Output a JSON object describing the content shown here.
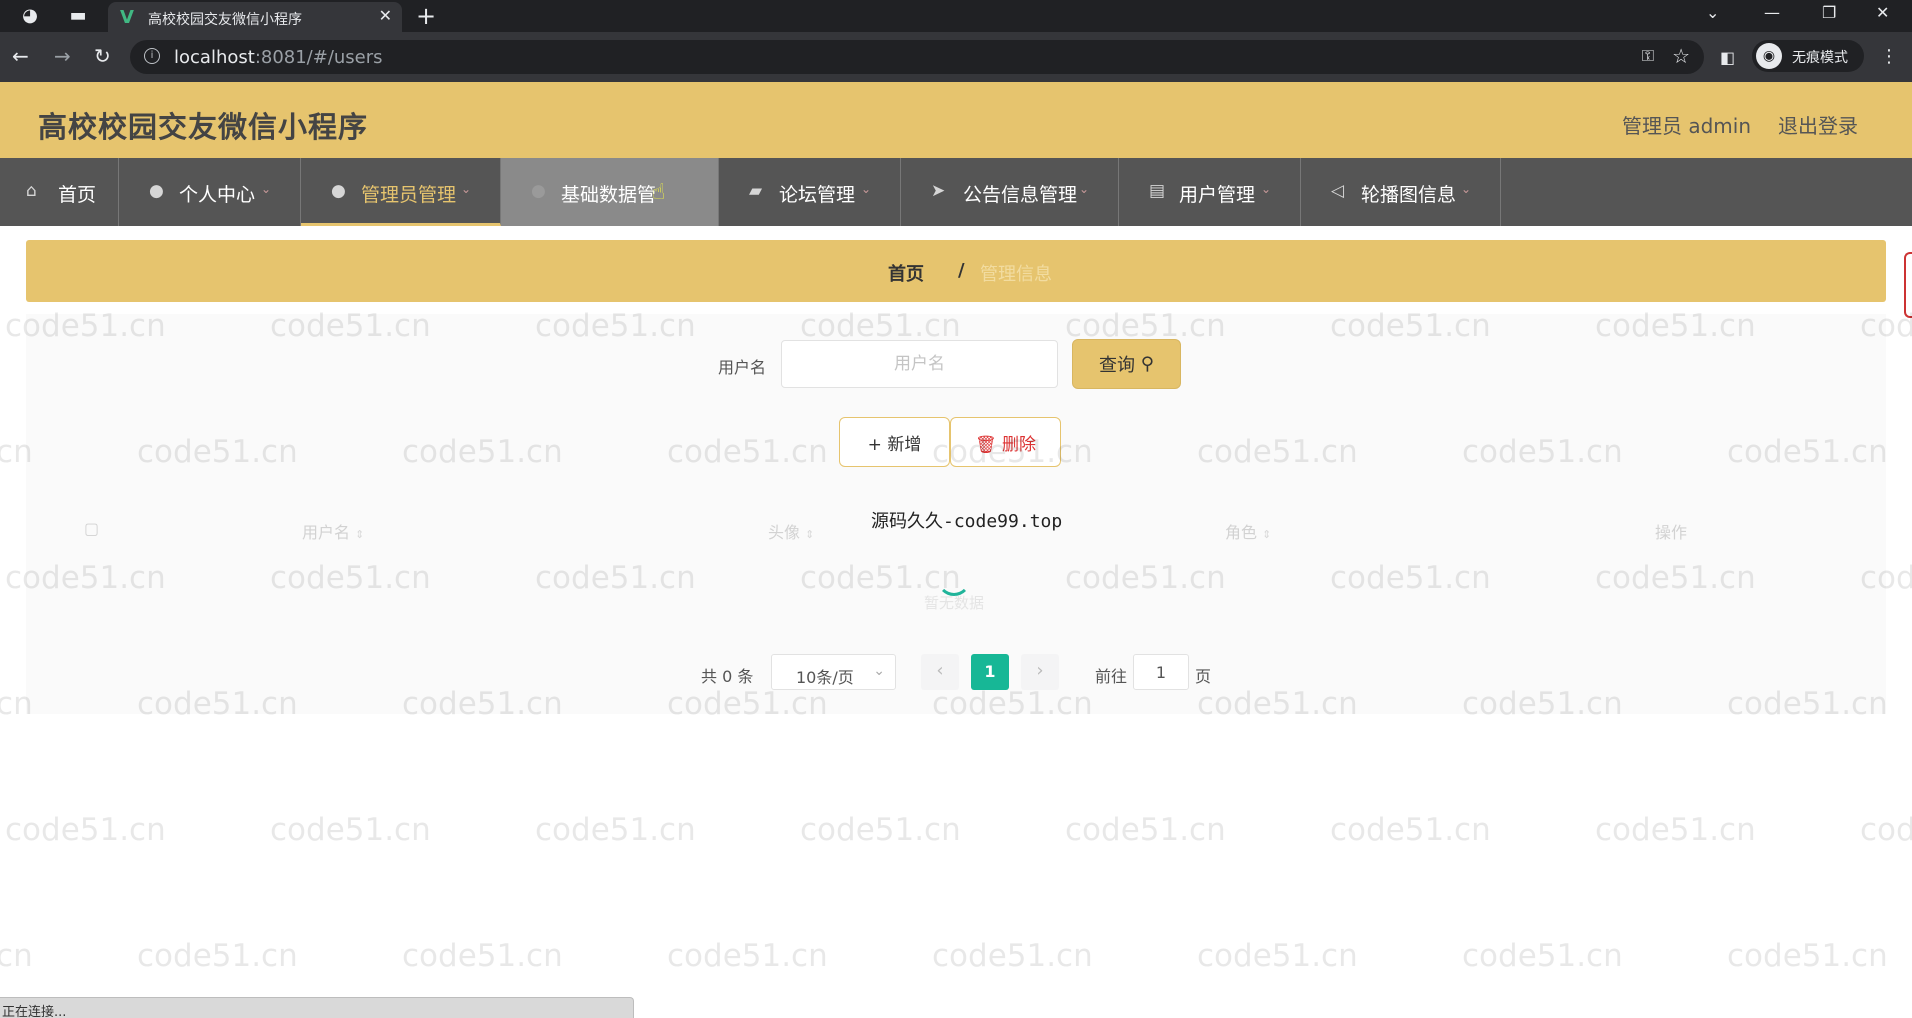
{
  "browser": {
    "tab_title": "高校校园交友微信小程序",
    "url_host": "localhost",
    "url_rest": ":8081/#/users",
    "incognito_label": "无痕模式",
    "status_text": "正在连接..."
  },
  "header": {
    "title": "高校校园交友微信小程序",
    "admin_label": "管理员 admin",
    "logout_label": "退出登录"
  },
  "nav": {
    "items": [
      {
        "label": "首页",
        "icon": "home-icon"
      },
      {
        "label": "个人中心",
        "icon": "person-icon"
      },
      {
        "label": "管理员管理",
        "icon": "person-icon"
      },
      {
        "label": "基础数据管",
        "icon": "person-icon"
      },
      {
        "label": "论坛管理",
        "icon": "briefcase-icon"
      },
      {
        "label": "公告信息管理",
        "icon": "send-icon"
      },
      {
        "label": "用户管理",
        "icon": "clipboard-icon"
      },
      {
        "label": "轮播图信息",
        "icon": "navigation-icon"
      }
    ],
    "active_index": 2,
    "hover_index": 3
  },
  "breadcrumb": {
    "home": "首页",
    "separator": "/",
    "current": "管理信息"
  },
  "search": {
    "label": "用户名",
    "placeholder": "用户名",
    "value": "",
    "button_label": "查询"
  },
  "actions": {
    "add_label": "新增",
    "delete_label": "删除"
  },
  "table": {
    "columns": [
      "用户名",
      "头像",
      "角色",
      "操作"
    ],
    "empty_text": "暂无数据"
  },
  "annotation": "源码久久-code99.top",
  "pagination": {
    "total_text": "共 0 条",
    "page_size": "10条/页",
    "current_page": "1",
    "goto_prefix": "前往",
    "goto_value": "1",
    "goto_suffix": "页"
  },
  "watermark": "code51.cn",
  "colors": {
    "header_bg": "#e6c46e",
    "nav_bg": "#555555",
    "active_page": "#17b796",
    "delete_text": "#dd3333"
  }
}
